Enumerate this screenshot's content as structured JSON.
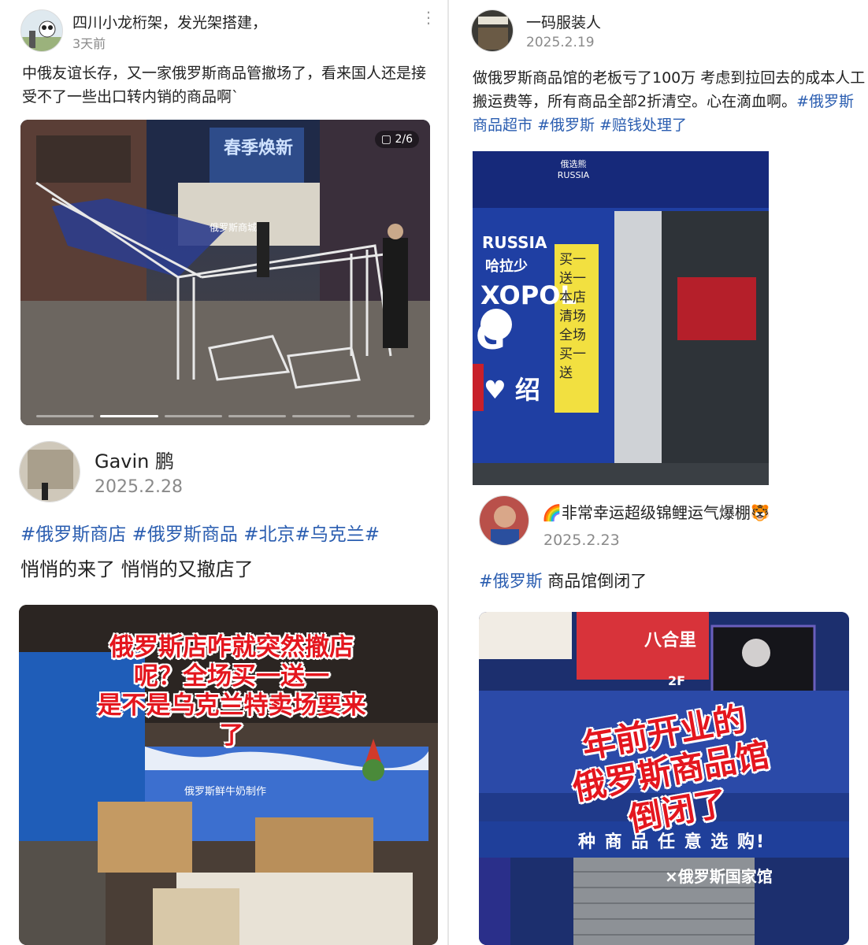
{
  "posts": [
    {
      "username": "四川小龙桁架，发光架搭建，",
      "date": "3天前",
      "text": "中俄友谊长存，又一家俄罗斯商品管撤场了，看来国人还是接受不了一些出口转内销的商品啊`",
      "image_counter": "2/6",
      "image_sign_text": "俄罗斯商城",
      "image_banner_text": "春季焕新"
    },
    {
      "username": "一码服装人",
      "date": "2025.2.19",
      "text": "做俄罗斯商品馆的老板亏了100万 考虑到拉回去的成本人工搬运费等，所有商品全部2折清空。心在滴血啊。",
      "tags": [
        "#俄罗斯商品超市",
        "#俄罗斯",
        "#赔钱处理了"
      ],
      "image_texts": {
        "logo": "俄选熊 RUSSIA",
        "brand": "RUSSIA",
        "brand_cn": "哈拉少",
        "xopo": "XOPOL",
        "g": "G",
        "heart": "♥ 绍",
        "notice": "买一送一本店清场全场买一送"
      }
    },
    {
      "username": "Gavin 鹏",
      "date": "2025.2.28",
      "tags": [
        "#俄罗斯商店",
        "#俄罗斯商品",
        "#北京",
        "#乌克兰",
        "#"
      ],
      "text": "悄悄的来了 悄悄的又撤店了",
      "overlay": [
        "俄罗斯店咋就突然撤店",
        "呢？全场买一送一",
        "是不是乌克兰特卖场要来",
        "了"
      ],
      "box_text": "俄罗斯鲜牛奶制作"
    },
    {
      "username_emoji_left": "🌈",
      "username": "非常幸运超级锦鲤运气爆棚",
      "username_emoji_right": "🐯",
      "date": "2025.2.23",
      "tags": [
        "#俄罗斯"
      ],
      "text": " 商品馆倒闭了",
      "overlay": [
        "年前开业的",
        "俄罗斯商品馆",
        "倒闭了"
      ],
      "sign_top": "八合里",
      "sign_floor": "2F",
      "sign_row": "种 商 品 任 意 选 购!",
      "sign_bottom": "×俄罗斯国家馆"
    }
  ],
  "colors": {
    "tag": "#2a5db0",
    "overlay_red": "#e4161e",
    "store_blue": "#1f3fa3"
  }
}
